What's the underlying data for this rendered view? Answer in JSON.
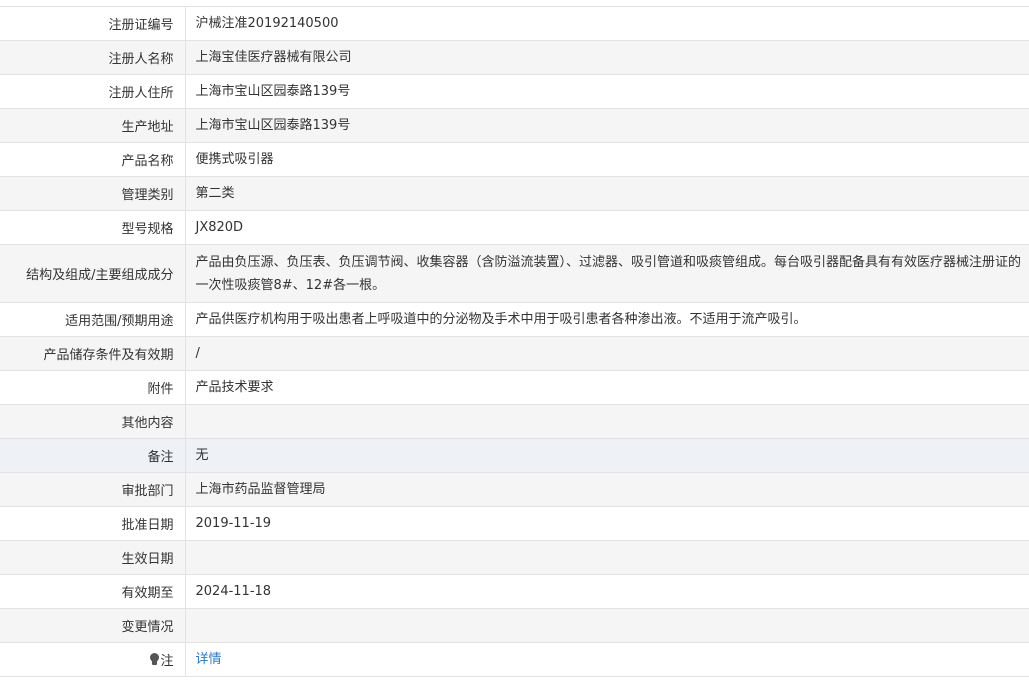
{
  "rows": [
    {
      "label": "注册证编号",
      "value": "沪械注准20192140500"
    },
    {
      "label": "注册人名称",
      "value": "上海宝佳医疗器械有限公司"
    },
    {
      "label": "注册人住所",
      "value": "上海市宝山区园泰路139号"
    },
    {
      "label": "生产地址",
      "value": "上海市宝山区园泰路139号"
    },
    {
      "label": "产品名称",
      "value": "便携式吸引器"
    },
    {
      "label": "管理类别",
      "value": "第二类"
    },
    {
      "label": "型号规格",
      "value": "JX820D"
    },
    {
      "label": "结构及组成/主要组成成分",
      "value": "产品由负压源、负压表、负压调节阀、收集容器（含防溢流装置）、过滤器、吸引管道和吸痰管组成。每台吸引器配备具有有效医疗器械注册证的一次性吸痰管8#、12#各一根。"
    },
    {
      "label": "适用范围/预期用途",
      "value": "产品供医疗机构用于吸出患者上呼吸道中的分泌物及手术中用于吸引患者各种渗出液。不适用于流产吸引。"
    },
    {
      "label": "产品储存条件及有效期",
      "value": "/"
    },
    {
      "label": "附件",
      "value": "产品技术要求"
    },
    {
      "label": "其他内容",
      "value": ""
    },
    {
      "label": "备注",
      "value": "无"
    },
    {
      "label": "审批部门",
      "value": "上海市药品监督管理局"
    },
    {
      "label": "批准日期",
      "value": "2019-11-19"
    },
    {
      "label": "生效日期",
      "value": ""
    },
    {
      "label": "有效期至",
      "value": "2024-11-18"
    },
    {
      "label": "变更情况",
      "value": ""
    }
  ],
  "note_row": {
    "label": "注",
    "icon": "lightbulb-icon",
    "link_text": "详情",
    "link_color": "#2a7ac9"
  }
}
